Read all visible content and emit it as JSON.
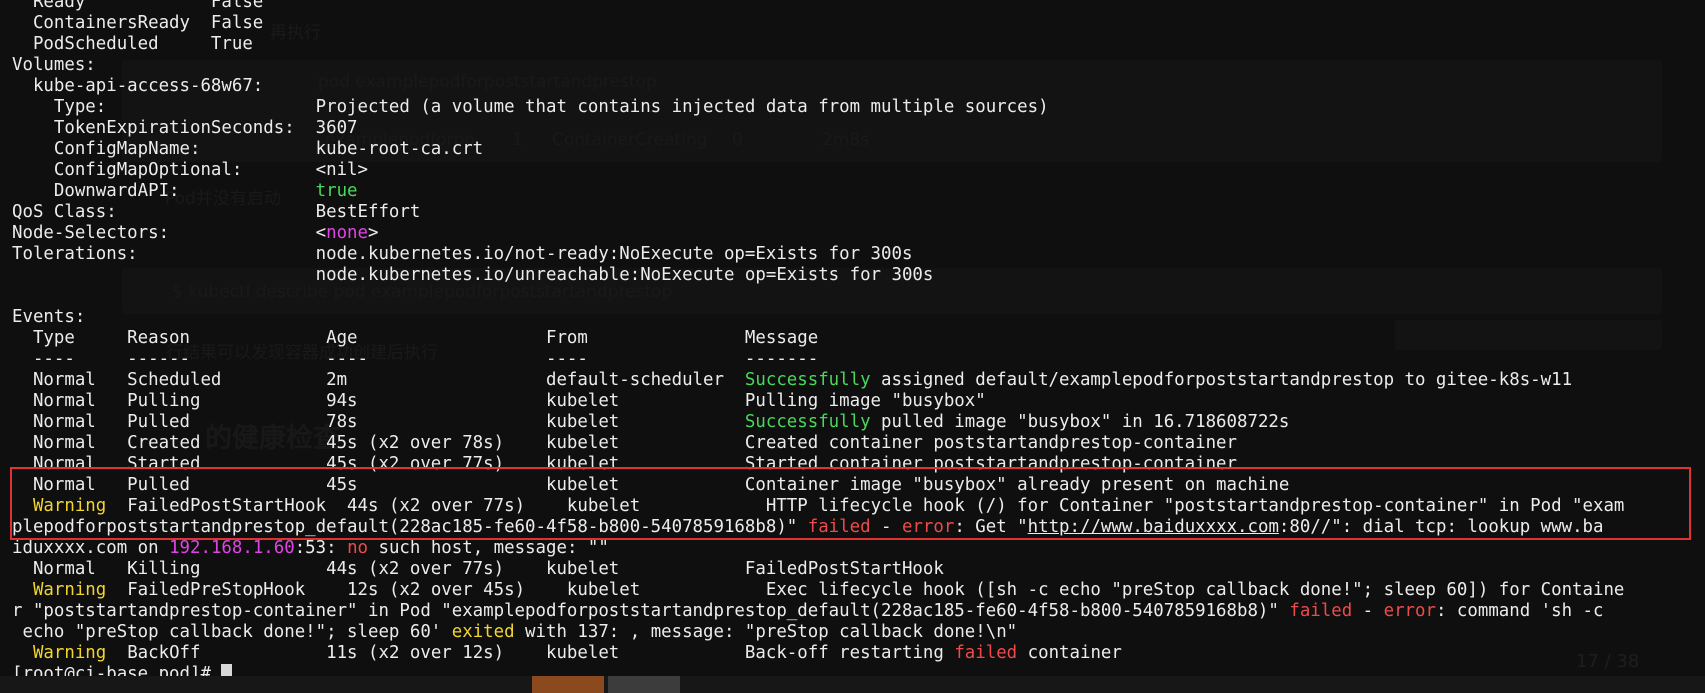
{
  "theme": {
    "background": "#1f1f1f",
    "text": "#ececec",
    "green": "#48d85c",
    "yellow": "#f1d52d",
    "red": "#ee4a4a",
    "magenta": "#e044e6",
    "highlight_border": "#dd3333"
  },
  "background_page": {
    "faint_text": [
      "再执行",
      "pod examplepodforpoststartandprestop",
      "examplepodforpo",
      "1",
      "ContainerCreating",
      "0",
      "2m8s",
      "Pod并没有启动",
      "$ kubectl describe pod examplepodforpoststartandprestop",
      "行结果可以发现容器成功创建后执行",
      "的健康检查",
      "17 / 38"
    ]
  },
  "terminal": {
    "lines": [
      [
        {
          "t": "  Ready            False"
        }
      ],
      [
        {
          "t": "  ContainersReady  False"
        }
      ],
      [
        {
          "t": "  PodScheduled     True"
        }
      ],
      [
        {
          "t": "Volumes:"
        }
      ],
      [
        {
          "t": "  kube-api-access-68w67:"
        }
      ],
      [
        {
          "t": "    Type:                    Projected (a volume that contains injected data from multiple sources)"
        }
      ],
      [
        {
          "t": "    TokenExpirationSeconds:  3607"
        }
      ],
      [
        {
          "t": "    ConfigMapName:           kube-root-ca.crt"
        }
      ],
      [
        {
          "t": "    ConfigMapOptional:       <nil>"
        }
      ],
      [
        {
          "t": "    DownwardAPI:             "
        },
        {
          "t": "true",
          "c": "green"
        }
      ],
      [
        {
          "t": "QoS Class:                   BestEffort"
        }
      ],
      [
        {
          "t": "Node-Selectors:              <"
        },
        {
          "t": "none",
          "c": "mag"
        },
        {
          "t": ">"
        }
      ],
      [
        {
          "t": "Tolerations:                 node.kubernetes.io/not-ready:NoExecute op=Exists for 300s"
        }
      ],
      [
        {
          "t": "                             node.kubernetes.io/unreachable:NoExecute op=Exists for 300s"
        }
      ],
      [
        {
          "t": ""
        }
      ],
      [
        {
          "t": "Events:"
        }
      ],
      [
        {
          "t": "  Type     Reason             Age                  From               Message"
        }
      ],
      [
        {
          "t": "  ----     ------             ----                 ----               -------"
        }
      ],
      [
        {
          "t": "  Normal   Scheduled          2m                   default-scheduler  "
        },
        {
          "t": "Successfully",
          "c": "green"
        },
        {
          "t": " assigned default/examplepodforpoststartandprestop to gitee-k8s-w11"
        }
      ],
      [
        {
          "t": "  Normal   Pulling            94s                  kubelet            Pulling image \"busybox\""
        }
      ],
      [
        {
          "t": "  Normal   Pulled             78s                  kubelet            "
        },
        {
          "t": "Successfully",
          "c": "green"
        },
        {
          "t": " pulled image \"busybox\" in 16.718608722s"
        }
      ],
      [
        {
          "t": "  Normal   Created            45s (x2 over 78s)    kubelet            Created container poststartandprestop-container"
        }
      ],
      [
        {
          "t": "  Normal   Started            45s (x2 over 77s)    kubelet            Started container poststartandprestop-container"
        }
      ],
      [
        {
          "t": "  Normal   Pulled             45s                  kubelet            Container image \"busybox\" already present on machine"
        }
      ],
      [
        {
          "t": "  "
        },
        {
          "t": "Warning",
          "c": "yellow"
        },
        {
          "t": "  FailedPostStartHook  44s (x2 over 77s)    kubelet            HTTP lifecycle hook (/) for Container \"poststartandprestop-container\" in Pod \"exam"
        }
      ],
      [
        {
          "t": "plepodforpoststartandprestop_default(228ac185-fe60-4f58-b800-5407859168b8)\" "
        },
        {
          "t": "failed",
          "c": "red"
        },
        {
          "t": " - "
        },
        {
          "t": "error",
          "c": "red"
        },
        {
          "t": ": Get \""
        },
        {
          "t": "http://www.baiduxxxx.com",
          "c": "link"
        },
        {
          "t": ":80//\": dial tcp: lookup www.ba"
        }
      ],
      [
        {
          "t": "iduxxxx.com on "
        },
        {
          "t": "192.168.1.60",
          "c": "mag"
        },
        {
          "t": ":53: "
        },
        {
          "t": "no",
          "c": "red"
        },
        {
          "t": " such host, message: \"\""
        }
      ],
      [
        {
          "t": "  Normal   Killing            44s (x2 over 77s)    kubelet            FailedPostStartHook"
        }
      ],
      [
        {
          "t": "  "
        },
        {
          "t": "Warning",
          "c": "yellow"
        },
        {
          "t": "  FailedPreStopHook    12s (x2 over 45s)    kubelet            Exec lifecycle hook ([sh -c echo \"preStop callback done!\"; sleep 60]) for Containe"
        }
      ],
      [
        {
          "t": "r \"poststartandprestop-container\" in Pod \"examplepodforpoststartandprestop_default(228ac185-fe60-4f58-b800-5407859168b8)\" "
        },
        {
          "t": "failed",
          "c": "red"
        },
        {
          "t": " - "
        },
        {
          "t": "error",
          "c": "red"
        },
        {
          "t": ": command 'sh -c"
        }
      ],
      [
        {
          "t": " echo \"preStop callback done!\"; sleep 60' "
        },
        {
          "t": "exited",
          "c": "yellow"
        },
        {
          "t": " with 137: , message: \"preStop callback done!\\n\""
        }
      ],
      [
        {
          "t": "  "
        },
        {
          "t": "Warning",
          "c": "yellow"
        },
        {
          "t": "  BackOff            11s (x2 over 12s)    kubelet            Back-off restarting "
        },
        {
          "t": "failed",
          "c": "red"
        },
        {
          "t": " container"
        }
      ],
      [
        {
          "t": "[root@ci-base pod]# "
        }
      ]
    ]
  }
}
